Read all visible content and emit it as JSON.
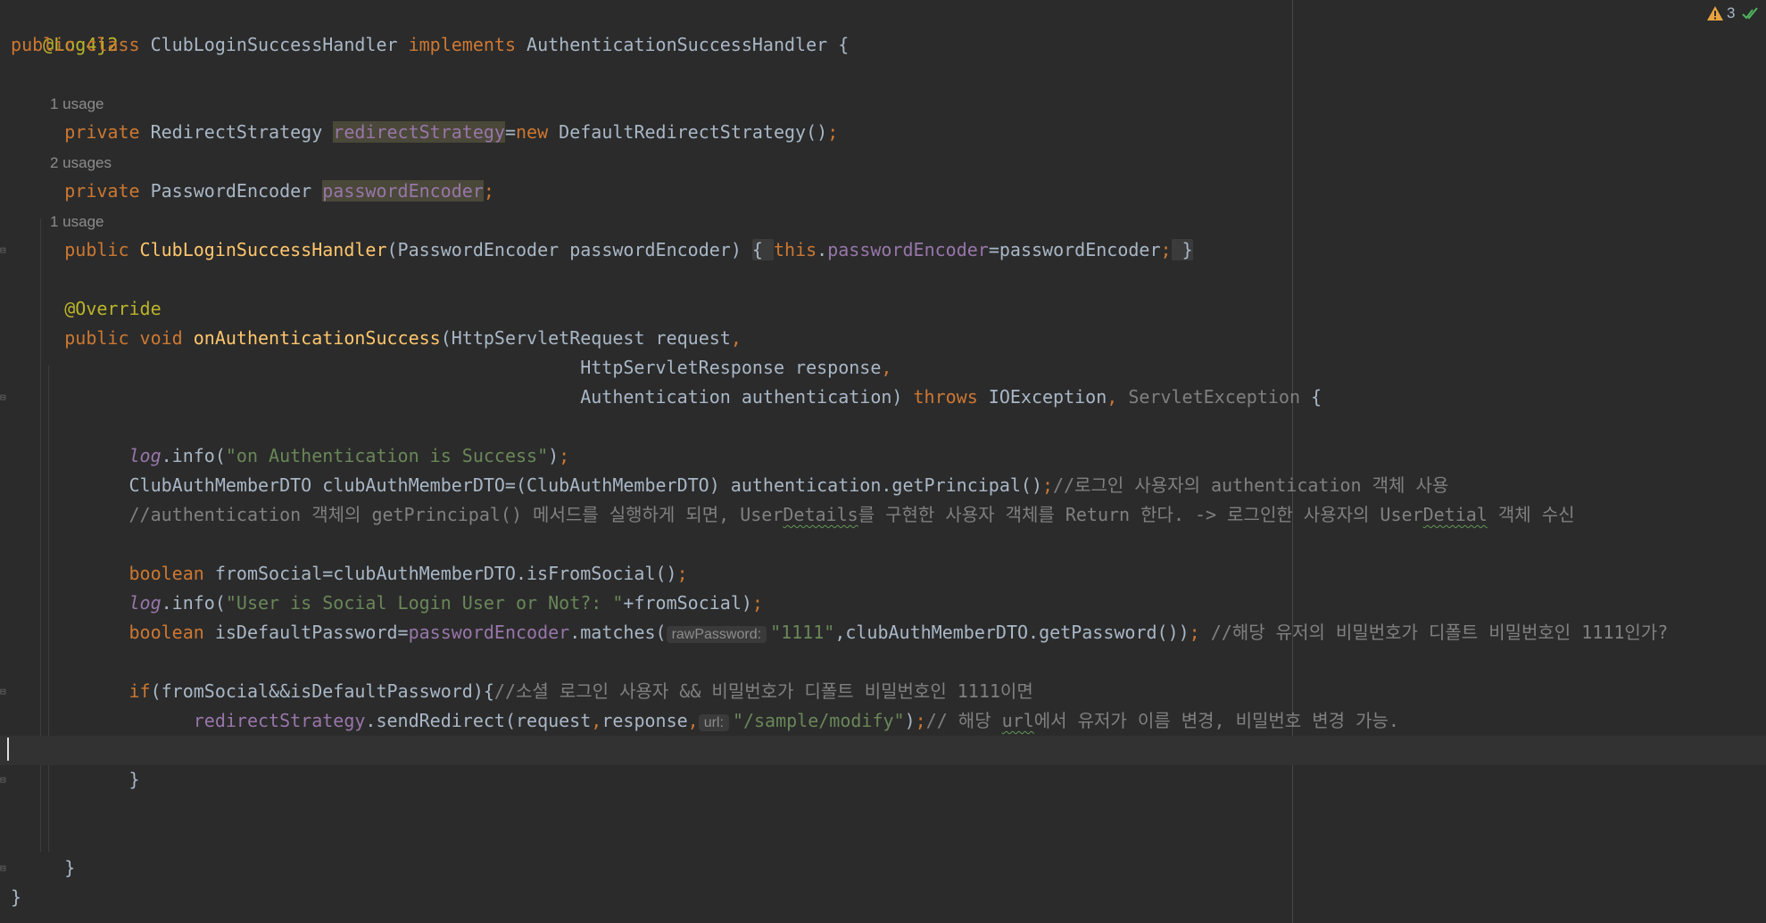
{
  "code": {
    "l1": {
      "annotation": "@Log4j2"
    },
    "l2": {
      "kw": "public class ",
      "name": "ClubLoginSuccessHandler ",
      "kw2": "implements ",
      "rest": "AuthenticationSuccessHandler {"
    },
    "hint1": "1 usage",
    "l3": {
      "kw": "private ",
      "type": "RedirectStrategy ",
      "field": "redirectStrategy",
      "eq": "=",
      "kw2": "new ",
      "rest": "DefaultRedirectStrategy()",
      "semi": ";"
    },
    "hint2": "2 usages",
    "l4": {
      "kw": "private ",
      "type": "PasswordEncoder ",
      "field": "passwordEncoder",
      "semi": ";"
    },
    "hint3": "1 usage",
    "l5": {
      "kw": "public ",
      "name": "ClubLoginSuccessHandler",
      "params": "(PasswordEncoder passwordEncoder) ",
      "open": "{ ",
      "this": "this",
      "dot": ".",
      "field": "passwordEncoder",
      "assign": "=passwordEncoder",
      "semi": ";",
      "close": " }"
    },
    "l6": {
      "annotation": "@Override"
    },
    "l7": {
      "kw": "public void ",
      "name": "onAuthenticationSuccess",
      "rest": "(HttpServletRequest request",
      "comma": ","
    },
    "l8": {
      "rest": "HttpServletResponse response",
      "comma": ","
    },
    "l9": {
      "rest": "Authentication authentication) ",
      "kw": "throws ",
      "exc": "IOException",
      "comma": ", ",
      "dim": "ServletException",
      "end": " {"
    },
    "l10": {
      "log": "log",
      "call": ".info(",
      "str": "\"on Authentication is Success\"",
      "end": ")",
      "semi": ";"
    },
    "l11": {
      "code": "ClubAuthMemberDTO clubAuthMemberDTO=(ClubAuthMemberDTO) authentication.getPrincipal()",
      "semi": ";",
      "comment": "//로그인 사용자의 authentication 객체 사용"
    },
    "l12": {
      "c1": "//authentication 객체의 getPrincipal() 메서드를 실행하게 되면, User",
      "c1sq": "Details",
      "c2": "를 구현한 사용자 객체를 Return 한다. -> 로그인한 사용자의 User",
      "c2sq": "Detial",
      "c3": " 객체 수신"
    },
    "l13": {
      "kw": "boolean ",
      "code": "fromSocial=clubAuthMemberDTO.isFromSocial()",
      "semi": ";"
    },
    "l14": {
      "log": "log",
      "call": ".info(",
      "str": "\"User is Social Login User or Not?: \"",
      "rest": "+fromSocial)",
      "semi": ";"
    },
    "l15": {
      "kw": "boolean ",
      "code": "isDefaultPassword=",
      "field": "passwordEncoder",
      "call": ".matches(",
      "hint": "rawPassword:",
      "str": "\"1111\"",
      "rest": ",clubAuthMemberDTO.getPassword())",
      "semi": ";",
      "comment": " //해당 유저의 비밀번호가 디폴트 비밀번호인 1111인가?"
    },
    "l16": {
      "kw": "if",
      "code": "(fromSocial&&isDefaultPassword){",
      "comment": "//소셜 로그인 사용자 && 비밀번호가 디폴트 비밀번호인 1111이면"
    },
    "l17": {
      "field": "redirectStrategy",
      "call": ".sendRedirect(request",
      "comma": ",",
      "arg": "response",
      "comma2": ",",
      "hint": "url:",
      "str": "\"/sample/modify\"",
      "end": ")",
      "semi": ";",
      "comment1": "// 해당 ",
      "commentsq": "url",
      "comment2": "에서 유저가 이름 변경, 비밀번호 변경 가능."
    },
    "l18": {
      "brace": "}"
    },
    "l19": {
      "brace": "}"
    },
    "l20": {
      "brace": "}"
    }
  },
  "inspections": {
    "warning_count": "3",
    "warn_color": "#e8a33e",
    "ok_color": "#4eb55d"
  },
  "icons": {
    "warning": "warning-triangle-icon",
    "check": "double-check-icon"
  }
}
